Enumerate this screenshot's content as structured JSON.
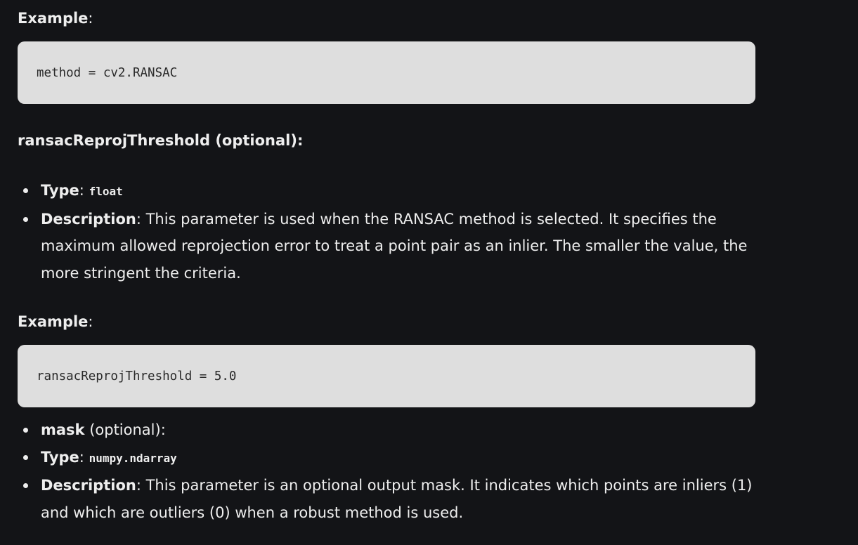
{
  "example1": {
    "label": "Example",
    "colon": ":",
    "code": "method = cv2.RANSAC"
  },
  "ransac_param": {
    "heading": "ransacReprojThreshold (optional):",
    "type_label": "Type",
    "type_colon": ": ",
    "type_value": "float",
    "desc_label": "Description",
    "desc_text": ": This parameter is used when the RANSAC method is selected. It specifies the maximum allowed reprojection error to treat a point pair as an inlier. The smaller the value, the more stringent the criteria."
  },
  "example2": {
    "label": "Example",
    "colon": ":",
    "code": "ransacReprojThreshold = 5.0"
  },
  "mask_param": {
    "name": "mask",
    "name_suffix": " (optional):",
    "type_label": "Type",
    "type_colon": ": ",
    "type_value": "numpy.ndarray",
    "desc_label": "Description",
    "desc_text": ": This parameter is an optional output mask. It indicates which points are inliers (1) and which are outliers (0) when a robust method is used."
  }
}
